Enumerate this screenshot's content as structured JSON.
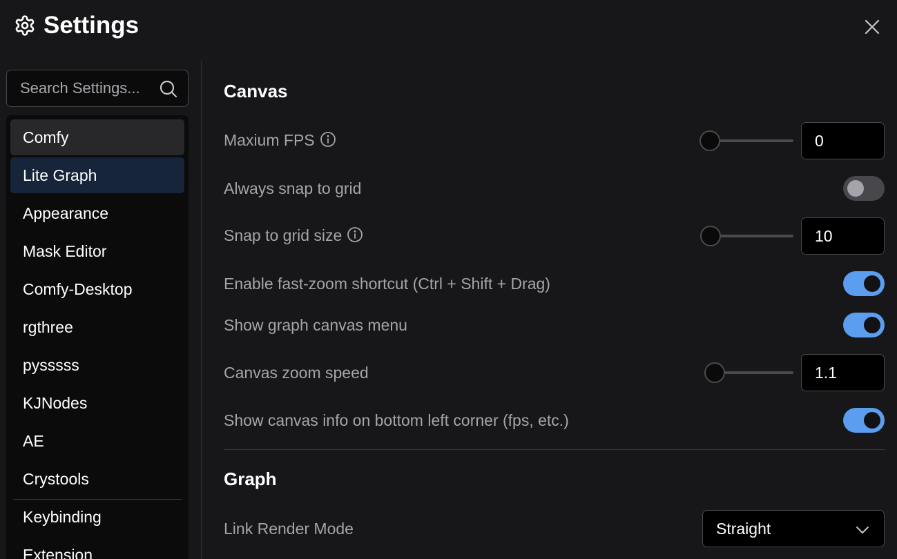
{
  "dialog": {
    "title": "Settings"
  },
  "search": {
    "placeholder": "Search Settings..."
  },
  "sidebar": {
    "items": [
      {
        "label": "Comfy"
      },
      {
        "label": "Lite Graph"
      },
      {
        "label": "Appearance"
      },
      {
        "label": "Mask Editor"
      },
      {
        "label": "Comfy-Desktop"
      },
      {
        "label": "rgthree"
      },
      {
        "label": "pysssss"
      },
      {
        "label": "KJNodes"
      },
      {
        "label": "AE"
      },
      {
        "label": "Crystools"
      },
      {
        "label": "Keybinding"
      },
      {
        "label": "Extension"
      }
    ],
    "active_index": 1,
    "hover_index": 0
  },
  "sections": {
    "canvas": {
      "title": "Canvas",
      "max_fps": {
        "label": "Maxium FPS",
        "value": "0",
        "has_info": true
      },
      "snap_to_grid": {
        "label": "Always snap to grid",
        "enabled": false
      },
      "snap_grid_size": {
        "label": "Snap to grid size",
        "value": "10",
        "has_info": true
      },
      "fast_zoom": {
        "label": "Enable fast-zoom shortcut (Ctrl + Shift + Drag)",
        "enabled": true
      },
      "canvas_menu": {
        "label": "Show graph canvas menu",
        "enabled": true
      },
      "zoom_speed": {
        "label": "Canvas zoom speed",
        "value": "1.1"
      },
      "canvas_info": {
        "label": "Show canvas info on bottom left corner (fps, etc.)",
        "enabled": true
      }
    },
    "graph": {
      "title": "Graph",
      "link_render_mode": {
        "label": "Link Render Mode",
        "value": "Straight"
      }
    }
  },
  "colors": {
    "background": "#171719",
    "sidebar": "#0b0b0c",
    "active_nav": "#16253a",
    "toggle_on": "#5b9ef0",
    "label": "#a4a4aa"
  }
}
